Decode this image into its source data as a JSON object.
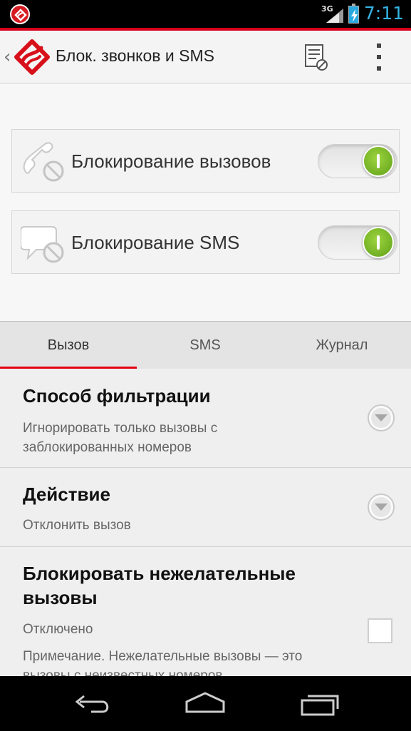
{
  "status_bar": {
    "network": "3G",
    "time": "7:11"
  },
  "action_bar": {
    "title": "Блок. звонков и SMS",
    "icons": [
      "app-logo-icon",
      "call-log-icon",
      "overflow-menu-icon"
    ]
  },
  "toggles": [
    {
      "label": "Блокирование вызовов",
      "icon": "phone-blocked-icon",
      "enabled": true
    },
    {
      "label": "Блокирование SMS",
      "icon": "sms-blocked-icon",
      "enabled": true
    }
  ],
  "tabs": [
    {
      "label": "Вызов",
      "selected": true
    },
    {
      "label": "SMS",
      "selected": false
    },
    {
      "label": "Журнал",
      "selected": false
    }
  ],
  "settings": {
    "filter": {
      "title": "Способ фильтрации",
      "value": "Игнорировать только вызовы с заблокированных номеров"
    },
    "action": {
      "title": "Действие",
      "value": "Отклонить вызов"
    },
    "unwanted": {
      "title": "Блокировать нежелательные вызовы",
      "value": "Отключено",
      "note": "Примечание. Нежелательные вызовы — это вызовы с неизвестных номеров",
      "checked": false
    }
  },
  "colors": {
    "accent_red": "#e3000f",
    "toggle_green": "#7cbf2a",
    "clock_blue": "#33b5e5"
  }
}
